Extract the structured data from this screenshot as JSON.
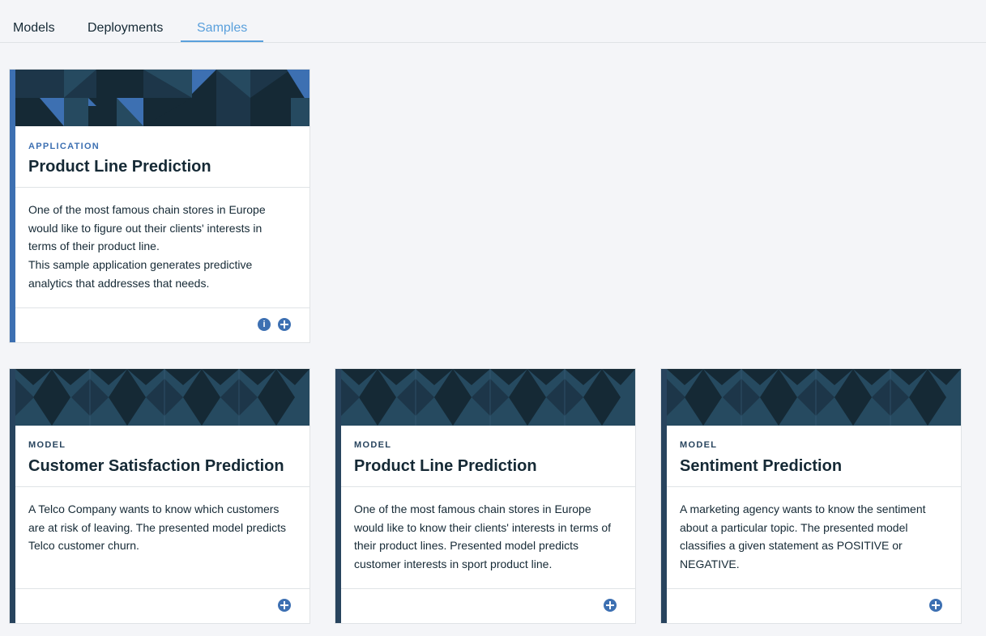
{
  "tabs": [
    {
      "label": "Models"
    },
    {
      "label": "Deployments"
    },
    {
      "label": "Samples"
    }
  ],
  "active_tab": "Samples",
  "cards": [
    {
      "type": "APPLICATION",
      "title": "Product Line Prediction",
      "description": [
        "One of the most famous chain stores in Europe would like to figure out their clients' interests in terms of their product line.",
        "This sample application generates predictive analytics that addresses that needs."
      ],
      "actions": [
        "info-icon",
        "add-icon"
      ]
    },
    {
      "type": "MODEL",
      "title": "Customer Satisfaction Prediction",
      "description": [
        "A Telco Company wants to know which customers are at risk of leaving. The presented model predicts Telco customer churn."
      ],
      "actions": [
        "add-icon"
      ]
    },
    {
      "type": "MODEL",
      "title": "Product Line Prediction",
      "description": [
        "One of the most famous chain stores in Europe would like to know their clients' interests in terms of their product lines. Presented model predicts customer interests in sport product line."
      ],
      "actions": [
        "add-icon"
      ]
    },
    {
      "type": "MODEL",
      "title": "Sentiment Prediction",
      "description": [
        "A marketing agency wants to know the sentiment about a particular topic. The presented model classifies a given statement as POSITIVE or NEGATIVE."
      ],
      "actions": [
        "add-icon"
      ]
    }
  ],
  "colors": {
    "accent": "#5aa0dc",
    "app_stripe": "#3d70b2",
    "model_stripe": "#28445e",
    "banner_dark": "#152935",
    "banner_mid": "#264a60",
    "banner_blue": "#3d70b2"
  }
}
